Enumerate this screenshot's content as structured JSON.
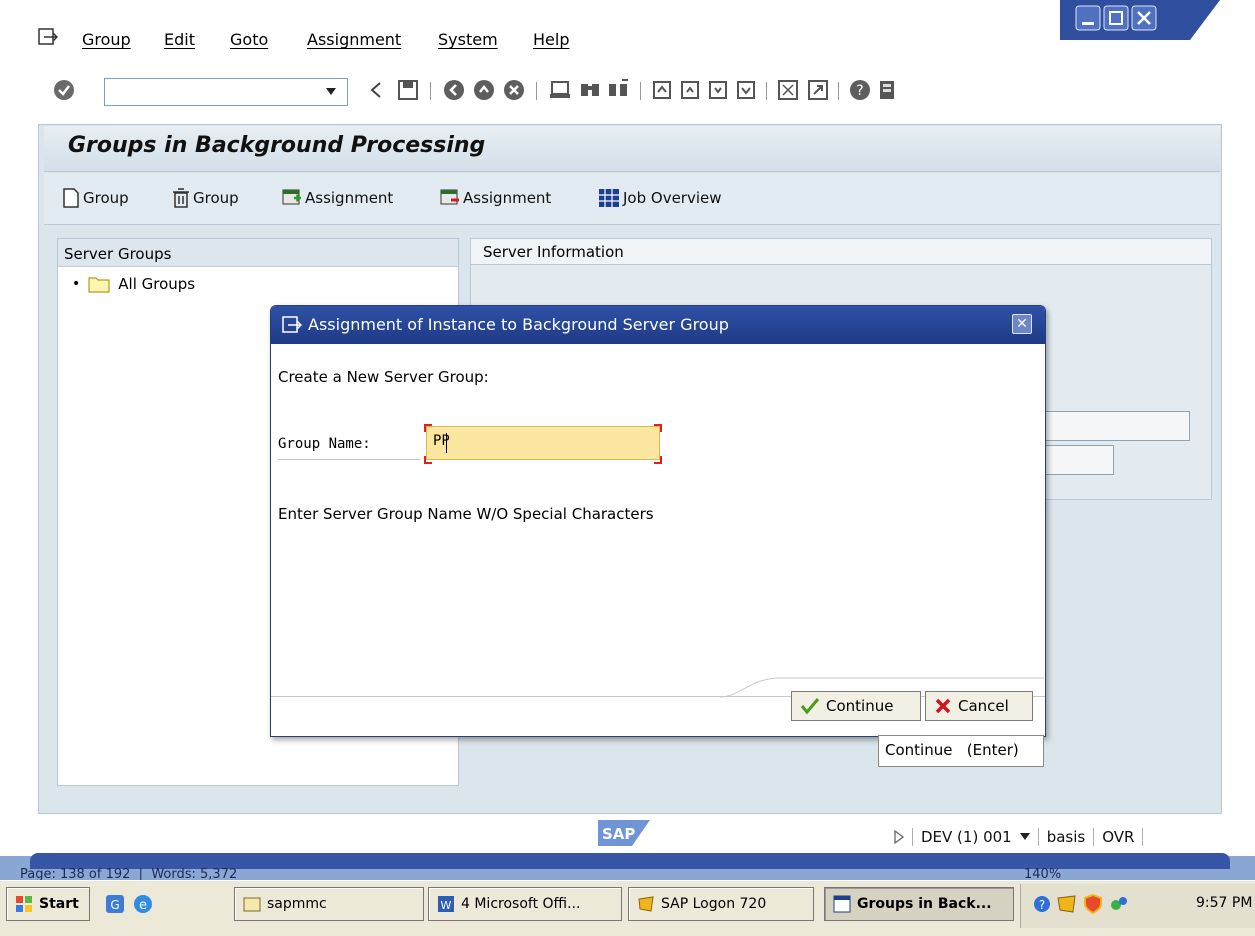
{
  "menubar": {
    "items": [
      "Group",
      "Edit",
      "Goto",
      "Assignment",
      "System",
      "Help"
    ]
  },
  "toolbar": {
    "command_field_value": ""
  },
  "page": {
    "title": "Groups in Background Processing"
  },
  "app_toolbar": {
    "buttons": [
      "Group",
      "Group",
      "Assignment",
      "Assignment",
      "Job Overview"
    ]
  },
  "left_panel": {
    "title": "Server Groups",
    "tree_item": "All Groups"
  },
  "right_panel": {
    "title": "Server Information"
  },
  "dialog": {
    "title": "Assignment of Instance to Background Server Group",
    "heading": "Create a New Server Group:",
    "group_name_label": "Group Name:",
    "group_name_value": "PP",
    "hint": "Enter Server Group Name W/O Special Characters",
    "continue_label": "Continue",
    "cancel_label": "Cancel",
    "tooltip": "Continue   (Enter)"
  },
  "status": {
    "system": "DEV (1) 001",
    "user": "basis",
    "mode": "OVR",
    "logo_text": "SAP"
  },
  "word_status": {
    "page": "Page: 138 of 192",
    "words": "Words: 5,372",
    "zoom": "140%"
  },
  "taskbar": {
    "start": "Start",
    "tasks": [
      "sapmmc",
      "4 Microsoft Offi...",
      "SAP Logon 720",
      "Groups in Back..."
    ],
    "clock": "9:57 PM"
  },
  "colors": {
    "dialog_title_bg": "#2f51a6",
    "input_bg": "#fbe7a0",
    "panel_bg": "#dbe5ec"
  }
}
